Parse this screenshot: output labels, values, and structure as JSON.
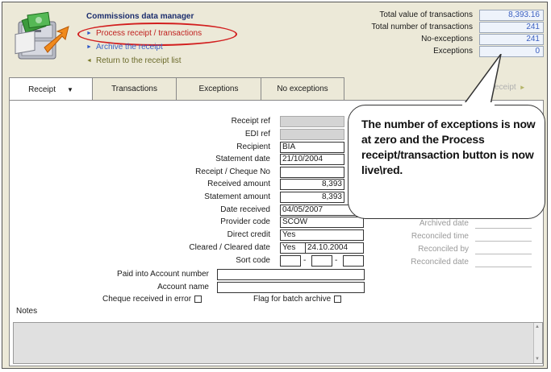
{
  "header": {
    "app_title": "Commissions data manager",
    "nav": [
      {
        "label": "Process receipt / transactions"
      },
      {
        "label": "Archive the receipt"
      },
      {
        "label": "Return to the receipt list"
      }
    ]
  },
  "stats": [
    {
      "label": "Total value of transactions",
      "value": "8,393.16"
    },
    {
      "label": "Total number of transactions",
      "value": "241"
    },
    {
      "label": "No-exceptions",
      "value": "241"
    },
    {
      "label": "Exceptions",
      "value": "0"
    }
  ],
  "tabs": [
    {
      "label": "Receipt"
    },
    {
      "label": "Transactions"
    },
    {
      "label": "Exceptions"
    },
    {
      "label": "No exceptions"
    }
  ],
  "tab_right_label": "eceipt",
  "form": {
    "receipt_ref": {
      "label": "Receipt ref",
      "value": ""
    },
    "edi_ref": {
      "label": "EDI ref",
      "value": ""
    },
    "recipient": {
      "label": "Recipient",
      "value": "BIA"
    },
    "statement_date": {
      "label": "Statement date",
      "value": "21/10/2004"
    },
    "receipt_cheque_no": {
      "label": "Receipt / Cheque No",
      "value": ""
    },
    "received_amount": {
      "label": "Received amount",
      "value": "8,393"
    },
    "statement_amount": {
      "label": "Statement amount",
      "value": "8,393"
    },
    "date_received": {
      "label": "Date received",
      "value": "04/05/2007"
    },
    "provider_code": {
      "label": "Provider code",
      "value": "SCOW"
    },
    "direct_credit": {
      "label": "Direct credit",
      "value": "Yes"
    },
    "cleared": {
      "label": "Cleared / Cleared date",
      "value": "Yes",
      "date": "24.10.2004"
    },
    "sort_code": {
      "label": "Sort code",
      "sep": "-"
    },
    "paid_into": {
      "label": "Paid into Account number",
      "value": ""
    },
    "account_name": {
      "label": "Account name",
      "value": ""
    },
    "cheque_error": {
      "label": "Cheque received in error"
    },
    "flag_batch": {
      "label": "Flag for batch archive"
    },
    "notes_label": "Notes"
  },
  "right_fields": [
    {
      "label": "Archived date"
    },
    {
      "label": "Reconciled time"
    },
    {
      "label": "Reconciled by"
    },
    {
      "label": "Reconciled date"
    }
  ],
  "callout": {
    "text": "The number of exceptions is now at zero and the Process receipt/transaction button is now live\\red."
  },
  "colors": {
    "process_link": "#c0201e",
    "archive_link": "#3a63c9",
    "return_link": "#6b6a2a",
    "highlight_oval": "#d21f1f",
    "stat_value": "#3a5fc0"
  }
}
